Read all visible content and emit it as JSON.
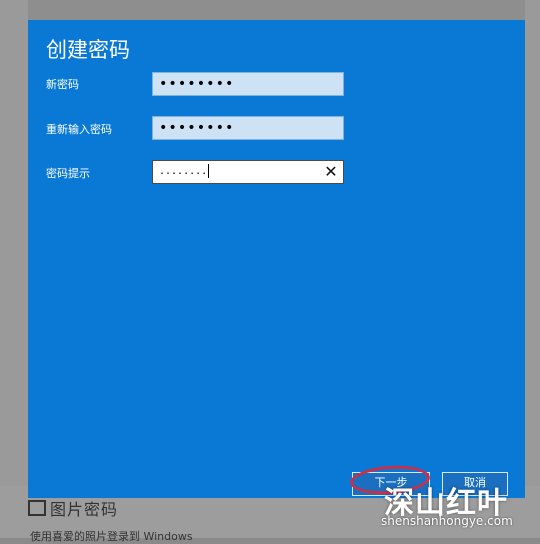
{
  "background": {
    "heading": "图片密码",
    "subtext": "使用喜爱的照片登录到 Windows"
  },
  "dialog": {
    "title": "创建密码",
    "fields": [
      {
        "label": "新密码",
        "value": "••••••••"
      },
      {
        "label": "重新输入密码",
        "value": "••••••••"
      },
      {
        "label": "密码提示",
        "value": "........"
      }
    ],
    "clear_icon": "close-icon",
    "next_label": "下一步",
    "cancel_label": "取消"
  },
  "watermark": {
    "text": "深山红叶",
    "url": "shenshanhongye.com"
  },
  "colors": {
    "dialog_bg": "#0a79d6",
    "highlight_ring": "#c7304a"
  }
}
